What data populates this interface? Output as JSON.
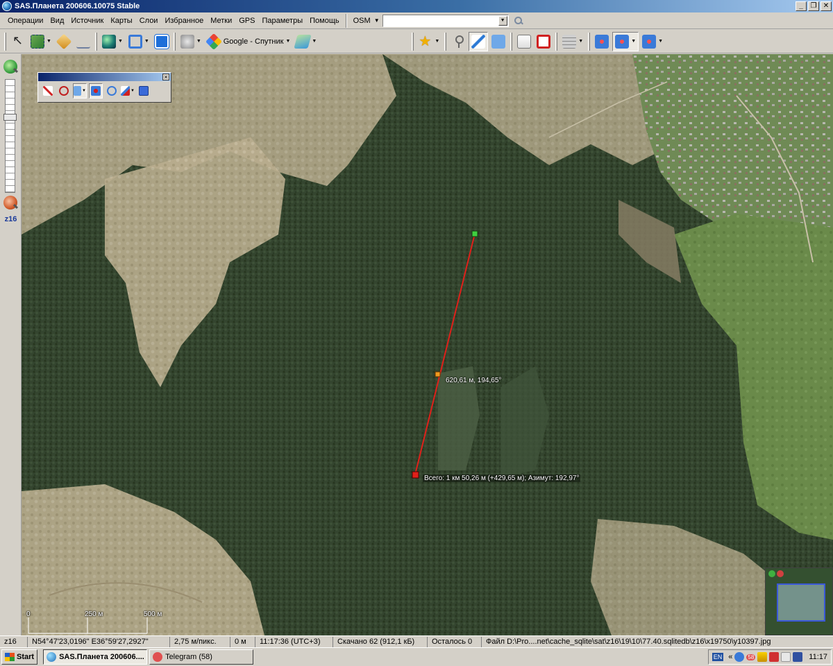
{
  "window": {
    "title": "SAS.Планета 200606.10075 Stable",
    "controls": [
      "_",
      "❐",
      "✕"
    ]
  },
  "menu": {
    "items": [
      "Операции",
      "Вид",
      "Источник",
      "Карты",
      "Слои",
      "Избранное",
      "Метки",
      "GPS",
      "Параметры",
      "Помощь"
    ],
    "map_source": "OSM",
    "search_value": ""
  },
  "toolbar": {
    "map_type_label": "Google - Спутник",
    "icons": [
      "cursor-icon",
      "select-area-icon",
      "ruler-icon",
      "compass-icon",
      "globe-icon",
      "zoom-icon",
      "fullscreen-icon",
      "satellite-icon",
      "google-maps-icon",
      "layers-icon",
      "favorites-star-icon",
      "placemark-icon",
      "path-icon",
      "polygon-icon",
      "marks-list-icon",
      "hide-marks-icon",
      "cache-icon",
      "gps-icon",
      "gps-track-icon",
      "gps-center-icon"
    ]
  },
  "zoom": {
    "level": "z16"
  },
  "measurement": {
    "segment_label": "620,61 м, 194,65°",
    "total_label": "Всего: 1 км 50,26 м (+429,65 м); Азимут: 192,97°"
  },
  "scale": {
    "labels": [
      "0",
      "250 м",
      "500 м"
    ]
  },
  "status": {
    "zoom": "z16",
    "coords": "N54°47'23,0196\" E36°59'27,2927\"",
    "resolution": "2,75 м/пикс.",
    "elevation": "0 м",
    "time": "11:17:36 (UTC+3)",
    "downloaded": "Скачано 62 (912,1 кБ)",
    "remaining": "Осталось 0",
    "file": "Файл D:\\Pro....net\\cache_sqlite\\sat\\z16\\19\\10\\77.40.sqlitedb\\z16\\x19750\\y10397.jpg"
  },
  "taskbar": {
    "start": "Start",
    "tasks": [
      {
        "label": "SAS.Планета 200606....",
        "active": true
      },
      {
        "label": "Telegram (58)",
        "active": false
      }
    ],
    "tray": {
      "lang": "EN",
      "chevron": "«",
      "badge": "58",
      "time": "11:17"
    }
  },
  "colors": {
    "measure_line": "#e0201a",
    "start_point": "#40d040",
    "mid_point": "#f09a20",
    "end_point": "#e0201a",
    "title_gradient_start": "#0a246a"
  }
}
